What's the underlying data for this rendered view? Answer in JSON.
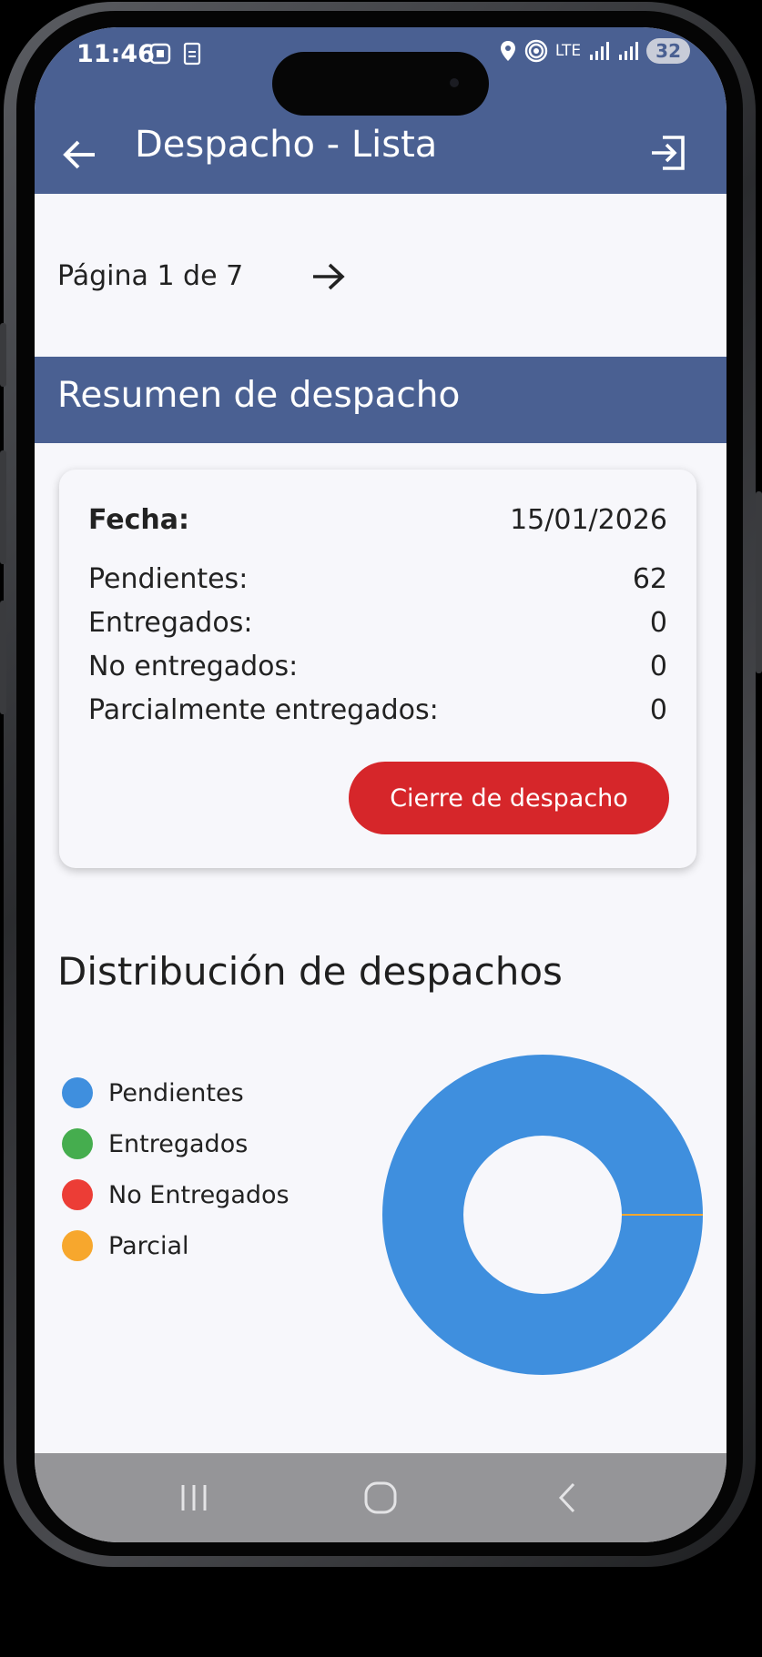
{
  "status_bar": {
    "time": "11:46",
    "network": "LTE",
    "battery": "32"
  },
  "app_bar": {
    "title": "Despacho - Lista",
    "back_icon": "arrow-left-icon",
    "logout_icon": "logout-icon"
  },
  "pagination": {
    "label": "Página 1 de 7",
    "next_icon": "arrow-right-icon"
  },
  "summary": {
    "section_title": "Resumen de despacho",
    "date_label": "Fecha:",
    "date_value": "15/01/2026",
    "rows": [
      {
        "label": "Pendientes:",
        "value": "62"
      },
      {
        "label": "Entregados:",
        "value": "0"
      },
      {
        "label": "No entregados:",
        "value": "0"
      },
      {
        "label": "Parcialmente entregados:",
        "value": "0"
      }
    ],
    "close_button": "Cierre de despacho"
  },
  "distribution": {
    "title": "Distribución de despachos"
  },
  "chart_data": {
    "type": "pie",
    "donut": true,
    "categories": [
      "Pendientes",
      "Entregados",
      "No Entregados",
      "Parcial"
    ],
    "values": [
      62,
      0,
      0,
      0
    ],
    "colors": [
      "#3f8fde",
      "#45ad4e",
      "#ec3d36",
      "#f7a72d"
    ],
    "legend_position": "left"
  },
  "colors": {
    "primary": "#4a6092",
    "danger": "#d6262a",
    "background": "#f7f7fb"
  },
  "nav_bar": {
    "recents_icon": "recents-icon",
    "home_icon": "home-icon",
    "back_icon": "nav-back-icon"
  }
}
